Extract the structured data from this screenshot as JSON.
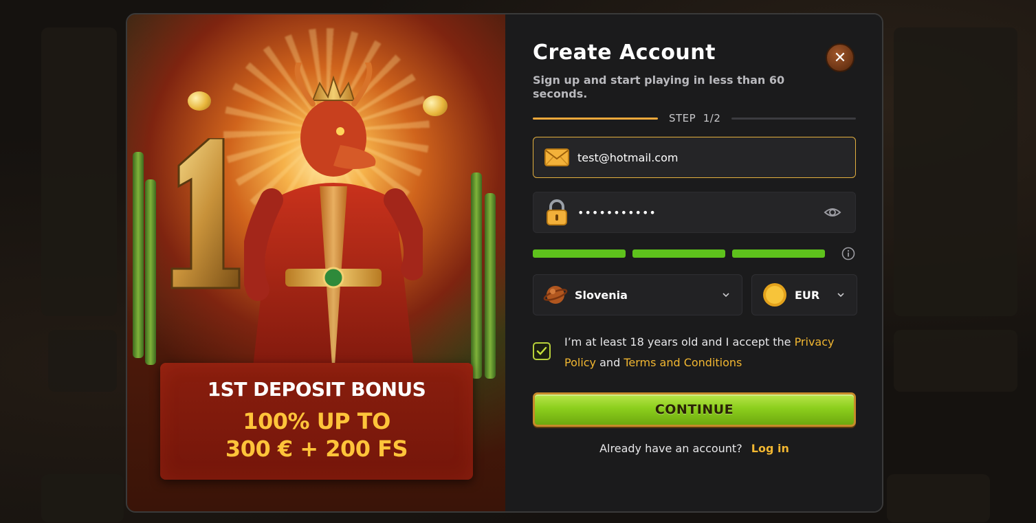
{
  "modal": {
    "title": "Create Account",
    "subtitle": "Sign up and start playing in less than 60 seconds.",
    "close_icon": "close-icon"
  },
  "promo": {
    "bonus_title": "1ST DEPOSIT BONUS",
    "bonus_line1": "100% UP TO",
    "bonus_line2": "300 € + 200 FS"
  },
  "step": {
    "label": "STEP",
    "value": "1/2",
    "current": 1,
    "total": 2
  },
  "email": {
    "value": "test@hotmail.com",
    "icon": "envelope-icon"
  },
  "password": {
    "masked_value": "•••••••••••",
    "icon": "lock-icon",
    "toggle_icon": "eye-icon"
  },
  "password_strength": {
    "filled_segments": 3,
    "total_segments": 3,
    "color": "#5ec21c",
    "info_icon": "info-icon"
  },
  "country": {
    "selected": "Slovenia",
    "icon": "globe-icon"
  },
  "currency": {
    "selected": "EUR",
    "icon": "coin-icon"
  },
  "terms": {
    "checked": true,
    "text_before": "I’m at least 18 years old and I accept the ",
    "privacy_link": "Privacy Policy",
    "text_middle": " and ",
    "terms_link": "Terms and Conditions"
  },
  "continue_button": {
    "label": "CONTINUE"
  },
  "login": {
    "prompt": "Already have an account?",
    "link": "Log in"
  },
  "colors": {
    "accent": "#f2b731",
    "button_green": "#8ccf1d",
    "panel_bg": "#1b1b1c",
    "bonus_bg": "#8a1e0e"
  }
}
